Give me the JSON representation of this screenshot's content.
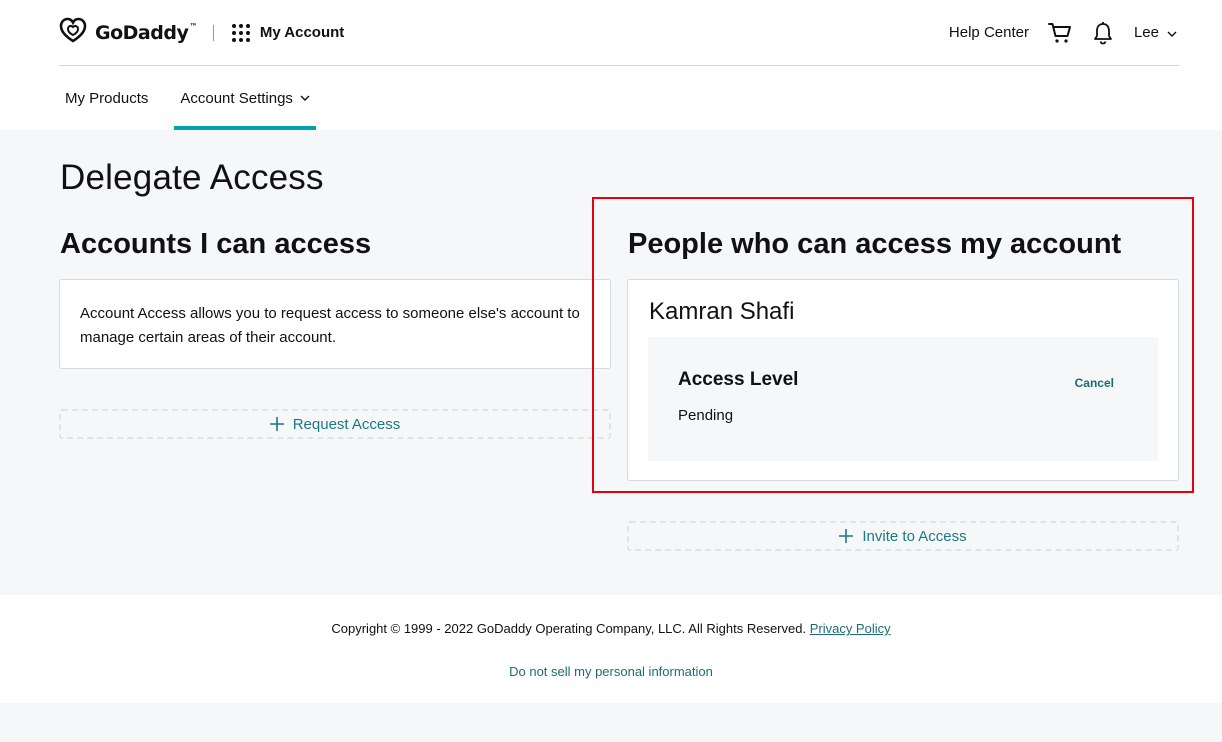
{
  "header": {
    "logo_text": "GoDaddy",
    "logo_tm": "™",
    "app_name": "My Account",
    "help_center": "Help Center",
    "user_name": "Lee"
  },
  "nav": {
    "items": [
      {
        "label": "My Products"
      },
      {
        "label": "Account Settings"
      }
    ]
  },
  "page": {
    "title": "Delegate Access",
    "left": {
      "title": "Accounts I can access",
      "description": "Account Access allows you to request access to someone else's account to manage certain areas of their account.",
      "request_button": "Request Access"
    },
    "right": {
      "title": "People who can access my account",
      "person_name": "Kamran Shafi",
      "access_level_label": "Access Level",
      "cancel_label": "Cancel",
      "status": "Pending",
      "invite_button": "Invite to Access"
    }
  },
  "footer": {
    "copyright": "Copyright © 1999 - 2022 GoDaddy Operating Company, LLC. All Rights Reserved.",
    "privacy_link": "Privacy Policy",
    "do_not_sell": "Do not sell my personal information"
  },
  "colors": {
    "accent_teal": "#00a4a6",
    "link_teal": "#1b6d73",
    "highlight_red": "#e3000f",
    "page_bg": "#f5f7f8"
  },
  "icons": [
    "godaddy-logo-icon",
    "apps-grid-icon",
    "cart-icon",
    "bell-icon",
    "chevron-down-icon",
    "plus-icon"
  ]
}
